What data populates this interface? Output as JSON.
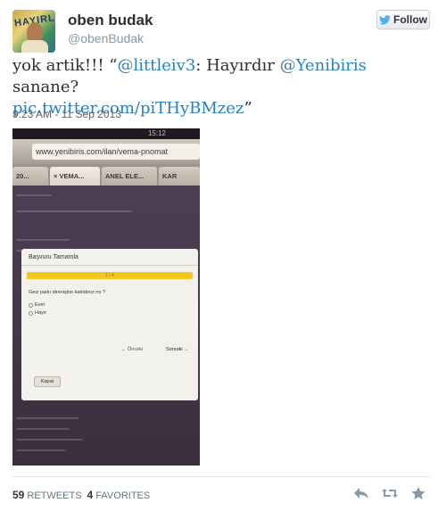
{
  "user": {
    "display_name": "oben budak",
    "handle": "@obenBudak",
    "avatar_icon": "profile-photo"
  },
  "follow_button": {
    "label": "Follow",
    "icon": "twitter-bird-icon"
  },
  "tweet": {
    "prefix": "yok artik!!! “",
    "mention_1": "@littleiv3",
    "middle": ": Hayırdır ",
    "mention_2": "@Yenibiris",
    "suffix": " sanane?",
    "link": "pic.twitter.com/piTHyBMzez",
    "close_quote": "”",
    "timestamp": "9:23 AM - 11 Sep 2013"
  },
  "photo": {
    "status_time": "15:12",
    "url": "www.yenibiris.com/ilan/vema-pnomat",
    "tabs": [
      "20...",
      "× VEMA...",
      "ANEL ELE...",
      "KAR"
    ],
    "dialog": {
      "title": "Başvuru Tamamla",
      "progress_text": "1 / 4",
      "question": "Gezi parkı direnişine katıldınız mı ?",
      "option_1": "Evet",
      "option_2": "Hayır",
      "prev": "← Önceki",
      "next": "Sonraki →",
      "close": "Kapat"
    }
  },
  "stats": {
    "retweets_count": "59",
    "retweets_label": "RETWEETS",
    "favorites_count": "4",
    "favorites_label": "FAVORITES"
  },
  "colors": {
    "link": "#2a7fbf",
    "progress": "#f2c623"
  }
}
